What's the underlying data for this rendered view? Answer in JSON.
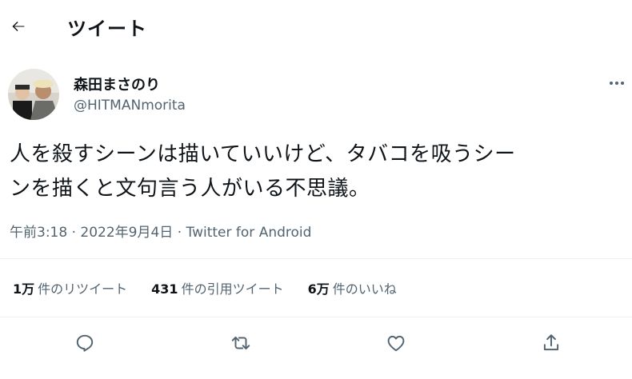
{
  "header": {
    "title": "ツイート"
  },
  "author": {
    "display_name": "森田まさのり",
    "handle": "@HITMANmorita"
  },
  "tweet": {
    "text_line1": "人を殺すシーンは描いていいけど、タバコを吸うシー",
    "text_line2": "ンを描くと文句言う人がいる不思議。"
  },
  "meta": {
    "time": "午前3:18",
    "date": "2022年9月4日",
    "source": "Twitter for Android"
  },
  "stats": [
    {
      "num": "1万",
      "label": "件のリツイート"
    },
    {
      "num": "431",
      "label": "件の引用ツイート"
    },
    {
      "num": "6万",
      "label": "件のいいね"
    }
  ],
  "icons": {
    "back": "arrow-left-icon",
    "more": "more-icon",
    "reply": "reply-icon",
    "retweet": "retweet-icon",
    "like": "heart-icon",
    "share": "share-icon"
  },
  "colors": {
    "text": "#0f1419",
    "secondary": "#536471",
    "divider": "#eff3f4"
  }
}
